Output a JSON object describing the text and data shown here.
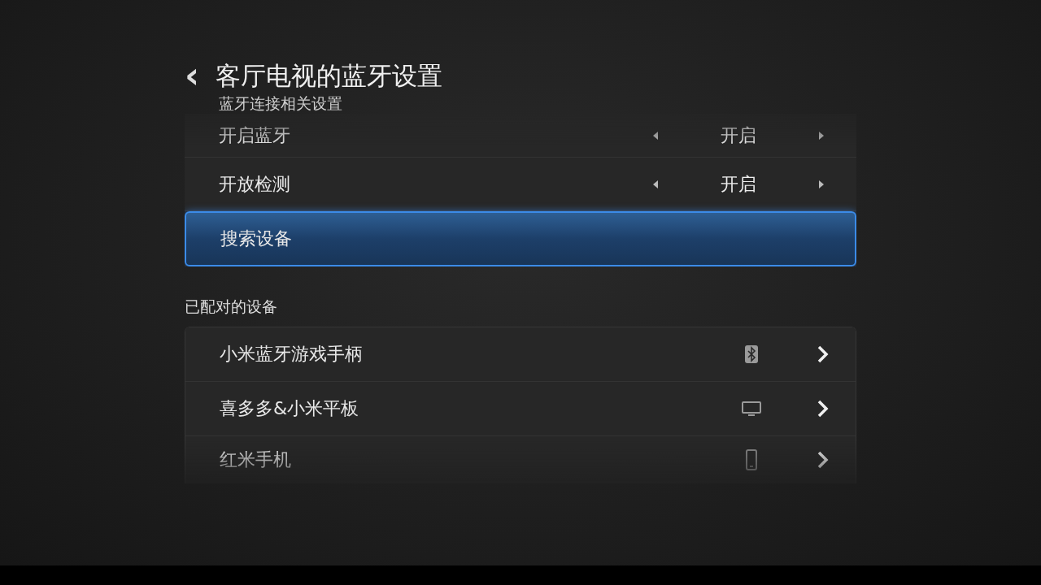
{
  "header": {
    "back": "‹",
    "title": "客厅电视的蓝牙设置",
    "subtitle": "蓝牙连接相关设置"
  },
  "settings": [
    {
      "kind": "option",
      "label": "开启蓝牙",
      "value": "开启",
      "selected": false
    },
    {
      "kind": "option",
      "label": "开放检测",
      "value": "开启",
      "selected": false
    },
    {
      "kind": "action",
      "label": "搜索设备",
      "selected": true
    }
  ],
  "paired_section": {
    "title": "已配对的设备"
  },
  "devices": [
    {
      "name": "小米蓝牙游戏手柄",
      "kind": "bluetooth",
      "selected": false
    },
    {
      "name": "喜多多&小米平板",
      "kind": "monitor",
      "selected": false
    },
    {
      "name": "红米手机",
      "kind": "phone",
      "selected": false
    }
  ]
}
